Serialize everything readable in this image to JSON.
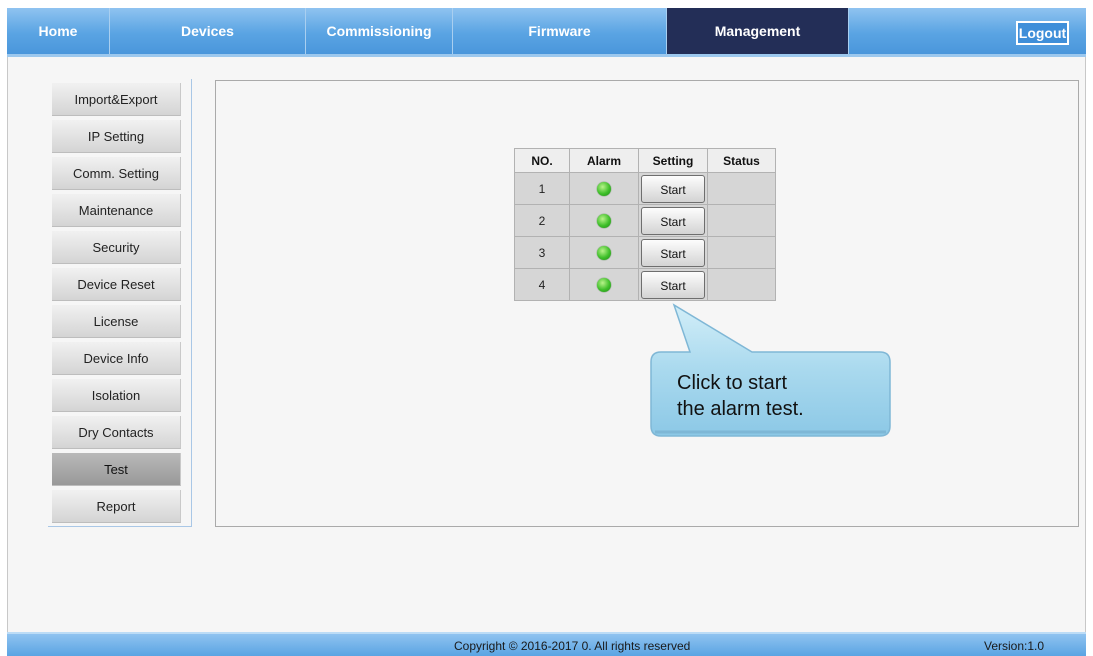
{
  "nav": {
    "tabs": [
      "Home",
      "Devices",
      "Commissioning",
      "Firmware",
      "Management"
    ],
    "active": "Management",
    "logout": "Logout"
  },
  "sidebar": {
    "items": [
      "Import&Export",
      "IP Setting",
      "Comm. Setting",
      "Maintenance",
      "Security",
      "Device Reset",
      "License",
      "Device Info",
      "Isolation",
      "Dry Contacts",
      "Test",
      "Report"
    ],
    "active": "Test"
  },
  "table": {
    "headers": [
      "NO.",
      "Alarm",
      "Setting",
      "Status"
    ],
    "rows": [
      {
        "no": "1",
        "alarm": "green",
        "setting": "Start",
        "status": ""
      },
      {
        "no": "2",
        "alarm": "green",
        "setting": "Start",
        "status": ""
      },
      {
        "no": "3",
        "alarm": "green",
        "setting": "Start",
        "status": ""
      },
      {
        "no": "4",
        "alarm": "green",
        "setting": "Start",
        "status": ""
      }
    ]
  },
  "callout": {
    "line1": "Click to start",
    "line2": "the alarm test."
  },
  "footer": {
    "copyright": "Copyright © 2016-2017 0. All rights reserved",
    "version": "Version:1.0"
  },
  "colors": {
    "nav_bg": "#5aa4e3",
    "nav_active": "#232e57",
    "led_green": "#3fbf2a",
    "callout_fill": "#a9d9ee"
  }
}
